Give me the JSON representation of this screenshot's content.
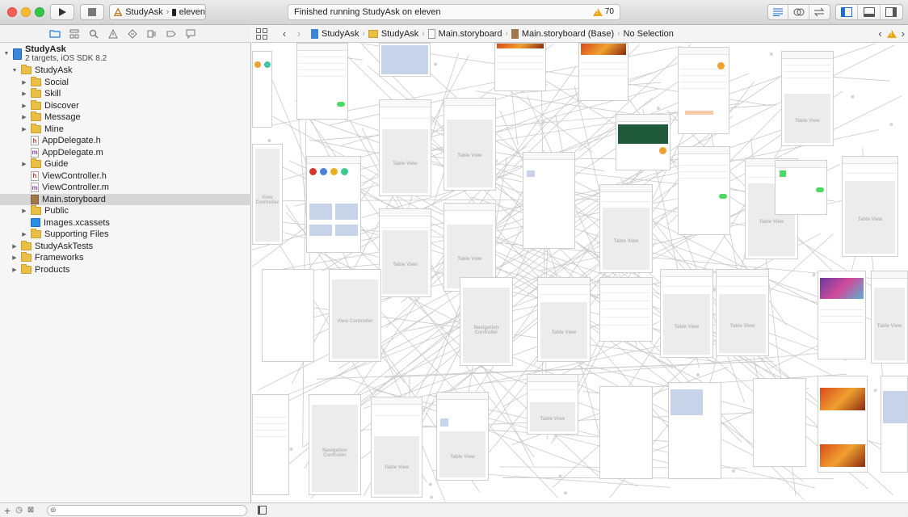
{
  "toolbar": {
    "scheme": "StudyAsk",
    "device": "eleven",
    "activity": "Finished running StudyAsk on eleven",
    "warning_count": "70"
  },
  "navigator": {
    "project_name": "StudyAsk",
    "project_sub": "2 targets, iOS SDK 8.2",
    "items": [
      {
        "label": "StudyAsk",
        "type": "folder",
        "depth": 1,
        "disclosure": "open"
      },
      {
        "label": "Social",
        "type": "folder",
        "depth": 2,
        "disclosure": "closed"
      },
      {
        "label": "Skill",
        "type": "folder",
        "depth": 2,
        "disclosure": "closed"
      },
      {
        "label": "Discover",
        "type": "folder",
        "depth": 2,
        "disclosure": "closed"
      },
      {
        "label": "Message",
        "type": "folder",
        "depth": 2,
        "disclosure": "closed"
      },
      {
        "label": "Mine",
        "type": "folder",
        "depth": 2,
        "disclosure": "closed"
      },
      {
        "label": "AppDelegate.h",
        "type": "h",
        "depth": 2,
        "disclosure": "none"
      },
      {
        "label": "AppDelegate.m",
        "type": "m",
        "depth": 2,
        "disclosure": "none"
      },
      {
        "label": "Guide",
        "type": "folder",
        "depth": 2,
        "disclosure": "closed"
      },
      {
        "label": "ViewController.h",
        "type": "h",
        "depth": 2,
        "disclosure": "none"
      },
      {
        "label": "ViewController.m",
        "type": "m",
        "depth": 2,
        "disclosure": "none"
      },
      {
        "label": "Main.storyboard",
        "type": "storyboard",
        "depth": 2,
        "disclosure": "none",
        "selected": true
      },
      {
        "label": "Public",
        "type": "folder",
        "depth": 2,
        "disclosure": "closed"
      },
      {
        "label": "Images.xcassets",
        "type": "xcassets",
        "depth": 2,
        "disclosure": "none"
      },
      {
        "label": "Supporting Files",
        "type": "folder",
        "depth": 2,
        "disclosure": "closed"
      },
      {
        "label": "StudyAskTests",
        "type": "folder",
        "depth": 1,
        "disclosure": "closed"
      },
      {
        "label": "Frameworks",
        "type": "folder",
        "depth": 1,
        "disclosure": "closed"
      },
      {
        "label": "Products",
        "type": "folder",
        "depth": 1,
        "disclosure": "closed"
      }
    ]
  },
  "jumpbar": {
    "crumbs": [
      "StudyAsk",
      "StudyAsk",
      "Main.storyboard",
      "Main.storyboard (Base)",
      "No Selection"
    ]
  },
  "canvas": {
    "labels": {
      "table_view": "Table View",
      "navigation_controller": "Navigation Controller",
      "view_controller": "View Controller"
    }
  }
}
